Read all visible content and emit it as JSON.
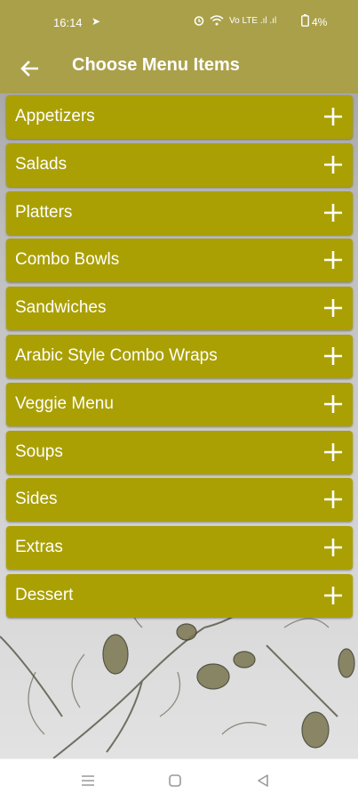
{
  "status_bar": {
    "time": "16:14",
    "telegram_glyph": "➤",
    "signal_text": "Vo LTE  .ıl  .ıl",
    "battery_text": "4%"
  },
  "app_bar": {
    "title": "Choose Menu Items",
    "back_icon": "arrow-left-icon"
  },
  "menu": {
    "items": [
      {
        "label": "Appetizers"
      },
      {
        "label": "Salads"
      },
      {
        "label": "Platters"
      },
      {
        "label": "Combo Bowls"
      },
      {
        "label": "Sandwiches"
      },
      {
        "label": "Arabic Style Combo Wraps"
      },
      {
        "label": "Veggie Menu"
      },
      {
        "label": "Soups"
      },
      {
        "label": "Sides"
      },
      {
        "label": "Extras"
      },
      {
        "label": "Dessert"
      }
    ],
    "expand_icon": "plus-icon"
  },
  "nav_bar": {
    "buttons": [
      "menu-lines-icon",
      "home-square-icon",
      "back-triangle-icon"
    ]
  },
  "colors": {
    "header": "#aaa04a",
    "item_background": "#aaa004",
    "text": "#ffffff"
  }
}
